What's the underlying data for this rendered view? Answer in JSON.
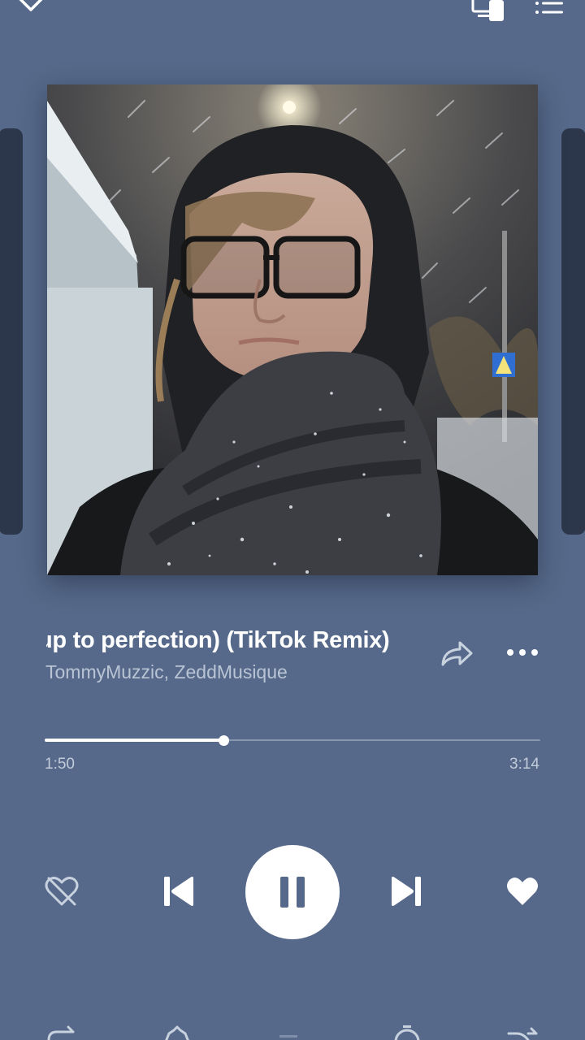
{
  "track": {
    "title": "up to perfection) (TikTok Remix)",
    "artists": "TommyMuzzic, ZeddMusique",
    "elapsed": "1:50",
    "duration": "3:14",
    "progress": 0.361
  },
  "icons": {
    "collapse": "chevron-down-icon",
    "devices": "devices-icon",
    "queue": "queue-list-icon",
    "share": "share-icon",
    "more": "more-dots-icon",
    "dislike": "dislike-heart-icon",
    "prev": "skip-previous-icon",
    "pause": "pause-icon",
    "next": "skip-next-icon",
    "like": "heart-filled-icon"
  },
  "colors": {
    "background": "#56698a",
    "accent": "#ffffff",
    "secondary_text": "#b9c4d4"
  }
}
